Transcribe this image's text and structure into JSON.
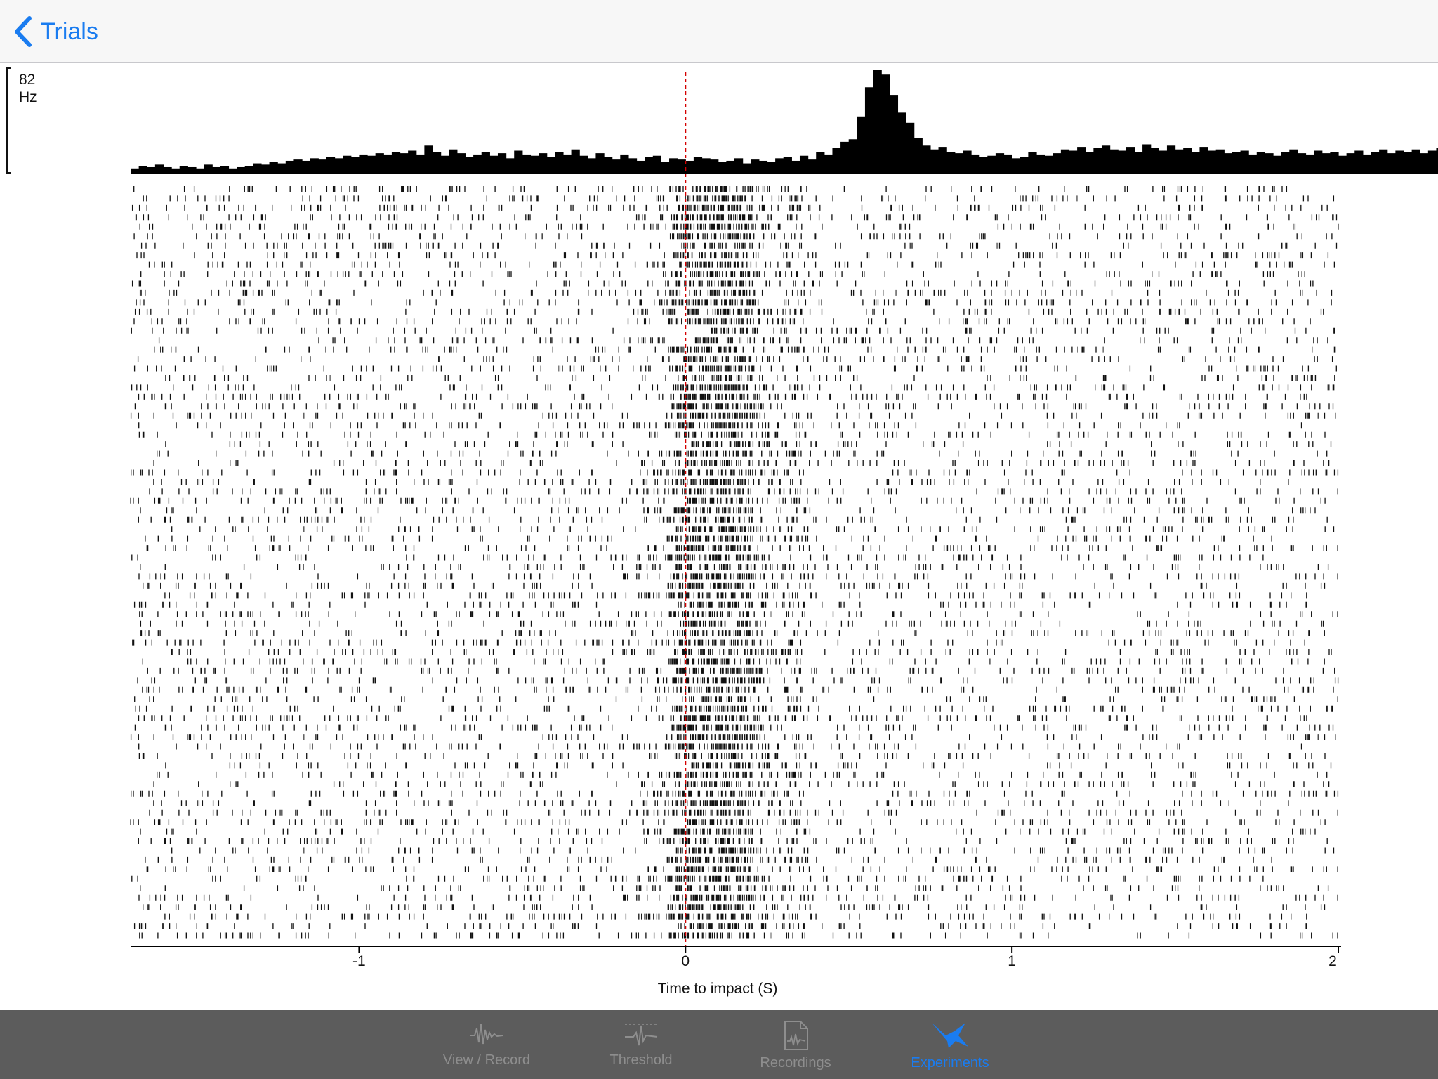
{
  "nav": {
    "back_label": "Trials"
  },
  "chart_data": {
    "type": "raster",
    "xlabel": "Time to impact (S)",
    "x_ticks": [
      "-1",
      "0",
      "1",
      "2"
    ],
    "xlim": [
      -1.7,
      2.0
    ],
    "event_time": 0,
    "hist_scale": {
      "value": "82",
      "unit": "Hz"
    },
    "histogram": {
      "bin_start": -1.7,
      "bin_width": 0.025,
      "rates": [
        4,
        6,
        5,
        7,
        5,
        4,
        6,
        5,
        4,
        7,
        5,
        6,
        4,
        5,
        6,
        8,
        7,
        9,
        8,
        10,
        11,
        10,
        12,
        11,
        13,
        12,
        14,
        13,
        15,
        14,
        16,
        15,
        17,
        16,
        18,
        15,
        22,
        17,
        14,
        19,
        16,
        13,
        15,
        17,
        14,
        16,
        12,
        18,
        15,
        14,
        16,
        13,
        17,
        15,
        19,
        14,
        12,
        16,
        13,
        11,
        15,
        12,
        10,
        13,
        14,
        9,
        12,
        11,
        10,
        13,
        12,
        11,
        9,
        10,
        12,
        8,
        11,
        10,
        9,
        12,
        13,
        10,
        14,
        11,
        17,
        15,
        20,
        25,
        27,
        45,
        68,
        82,
        78,
        62,
        48,
        40,
        28,
        22,
        19,
        21,
        17,
        16,
        18,
        15,
        13,
        14,
        16,
        15,
        12,
        13,
        17,
        15,
        14,
        16,
        19,
        18,
        21,
        17,
        20,
        22,
        19,
        18,
        21,
        17,
        23,
        20,
        18,
        22,
        19,
        20,
        17,
        21,
        18,
        19,
        16,
        17,
        18,
        15,
        17,
        16,
        14,
        17,
        19,
        16,
        15,
        18,
        16,
        17,
        14,
        16,
        18,
        15,
        17,
        19,
        16,
        18,
        17,
        19,
        16,
        18,
        20,
        19,
        22,
        18,
        17,
        20,
        19,
        17,
        21,
        18,
        16,
        19,
        20,
        18,
        17,
        22,
        19,
        18,
        21,
        16,
        19,
        14,
        20,
        15,
        11
      ]
    },
    "trials": 80
  },
  "tabs": [
    {
      "label": "View / Record",
      "icon": "waveform-icon",
      "active": false
    },
    {
      "label": "Threshold",
      "icon": "threshold-icon",
      "active": false
    },
    {
      "label": "Recordings",
      "icon": "recordings-icon",
      "active": false
    },
    {
      "label": "Experiments",
      "icon": "experiments-icon",
      "active": true
    }
  ],
  "colors": {
    "accent": "#1a7cf0",
    "event_line": "#d40000",
    "tabbar": "#5c5c5c"
  }
}
